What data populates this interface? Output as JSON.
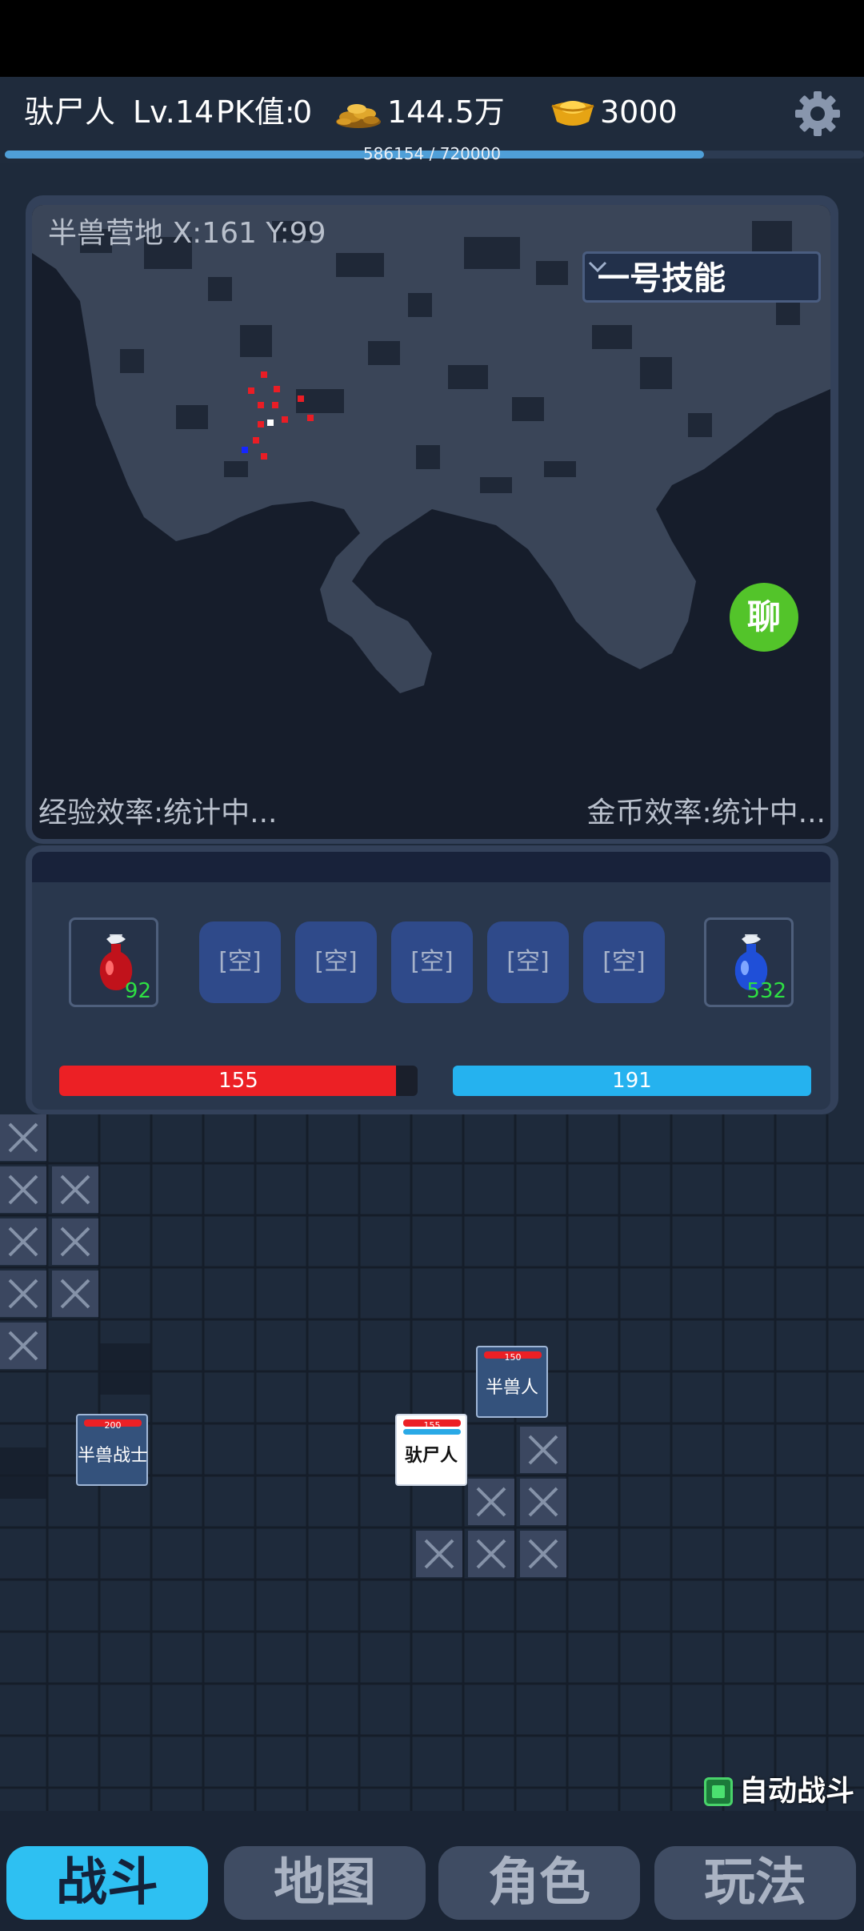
{
  "header": {
    "player_name": "驮尸人",
    "level": "Lv.14",
    "pk_label": "PK值:",
    "pk_value": "0",
    "coin_icon": "gold-coins-icon",
    "coins": "144.5万",
    "ingot_icon": "gold-ingot-icon",
    "gold": "3000",
    "settings_icon": "gear-icon"
  },
  "experience": {
    "text": "586154 / 720000",
    "current": 586154,
    "max": 720000
  },
  "map": {
    "location": "半兽营地 X:161 Y:99",
    "skill_select": "一号技能",
    "chat_button": "聊",
    "exp_efficiency": "经验效率:统计中...",
    "gold_efficiency": "金币效率:统计中..."
  },
  "actions": {
    "hp_potion_count": "92",
    "mp_potion_count": "532",
    "skill_slots": [
      "[空]",
      "[空]",
      "[空]",
      "[空]",
      "[空]"
    ],
    "hp": {
      "text": "155",
      "fraction": 0.94
    },
    "mp": {
      "text": "191",
      "fraction": 1.0
    }
  },
  "units": [
    {
      "name": "半兽人",
      "hp": "150",
      "type": "enemy"
    },
    {
      "name": "半兽战士",
      "hp": "200",
      "type": "enemy"
    },
    {
      "name": "驮尸人",
      "hp": "155",
      "type": "player"
    }
  ],
  "auto_battle": {
    "label": "自动战斗",
    "checked": true
  },
  "nav": {
    "battle": "战斗",
    "map": "地图",
    "character": "角色",
    "gameplay": "玩法"
  },
  "colors": {
    "hp": "#ec2025",
    "mp": "#25b2ef",
    "nav_active": "#2ec0f2",
    "chat": "#53c42a"
  }
}
